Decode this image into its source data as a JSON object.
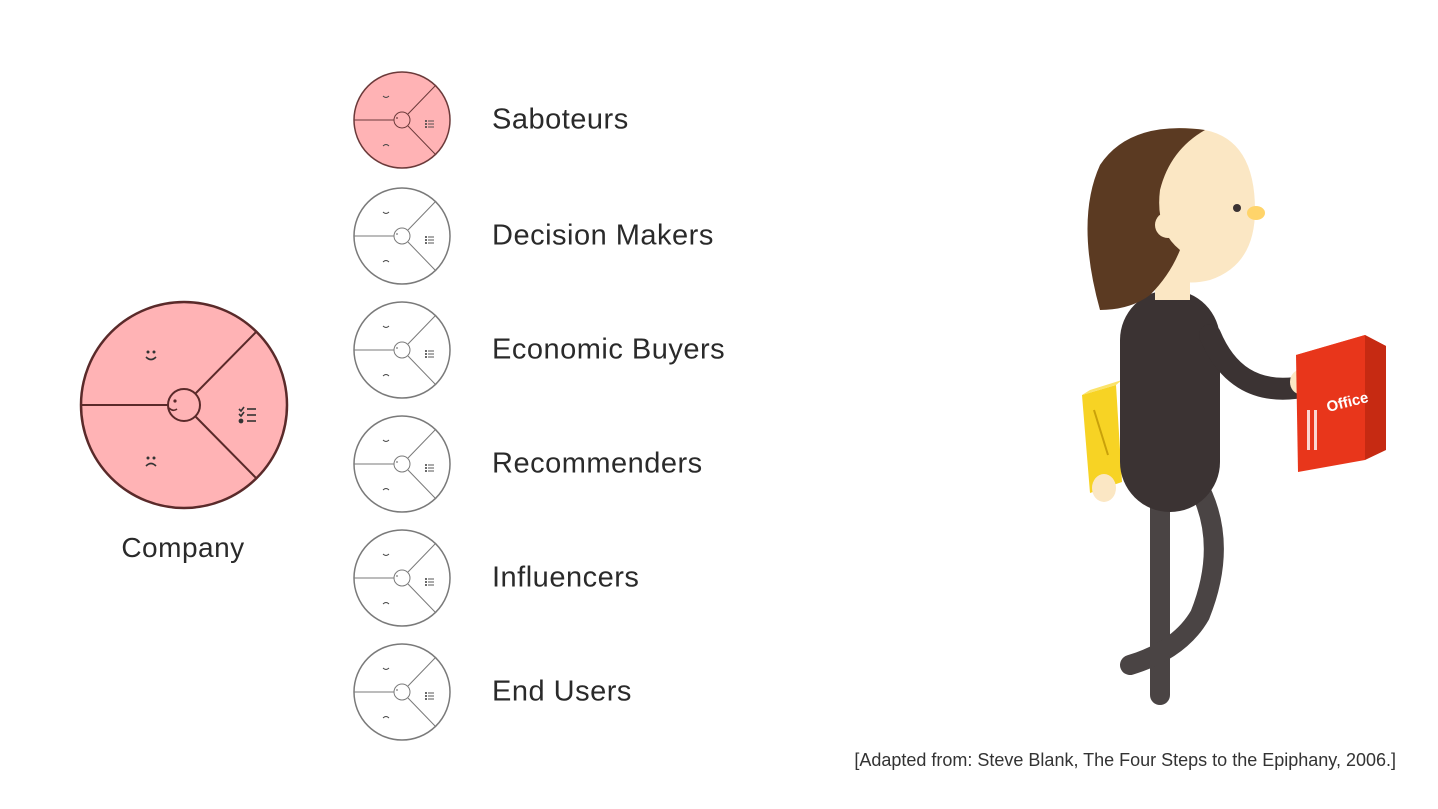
{
  "company": {
    "label": "Company",
    "fill": "#ffb3b5",
    "stroke": "#5a2a2a"
  },
  "roles": [
    {
      "label": "Saboteurs",
      "highlighted": true
    },
    {
      "label": "Decision Makers",
      "highlighted": false
    },
    {
      "label": "Economic Buyers",
      "highlighted": false
    },
    {
      "label": "Recommenders",
      "highlighted": false
    },
    {
      "label": "Influencers",
      "highlighted": false
    },
    {
      "label": "End Users",
      "highlighted": false
    }
  ],
  "wheel_icons": [
    "happy-face-icon",
    "sad-face-icon",
    "checklist-icon",
    "head-profile-icon"
  ],
  "colors": {
    "highlight_fill": "#ffb3b5",
    "neutral_fill": "#ffffff",
    "highlight_stroke": "#6b3a3a",
    "neutral_stroke": "#7a7a7a",
    "hair": "#5b3a22",
    "skin": "#fbe7c4",
    "nose": "#ffd46a",
    "body": "#3b3333",
    "legs": "#4a4444",
    "box_red": "#e8361b",
    "box_yellow": "#f7d324"
  },
  "illustration": {
    "box_brand": "Office"
  },
  "citation": "[Adapted from: Steve Blank, The Four Steps to the Epiphany, 2006.]"
}
